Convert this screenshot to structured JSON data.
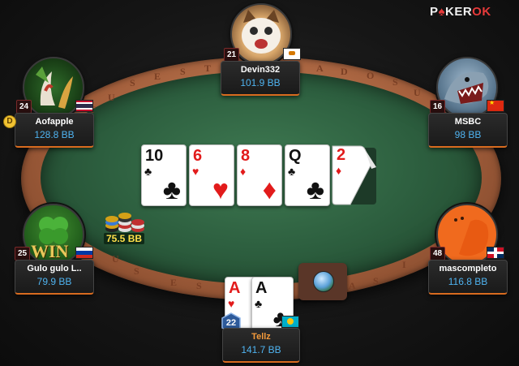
{
  "logo": {
    "pre": "P",
    "brand_rest": "KER",
    "ok": "OK"
  },
  "table": {
    "rail_text": "TUS ESTADOS UNIDOS"
  },
  "pot": {
    "amount": "75.5 BB"
  },
  "dealer_button": {
    "label": "D",
    "seat": "Aofapple"
  },
  "board": [
    {
      "rank": "10",
      "suit": "♣",
      "color": "#111111"
    },
    {
      "rank": "6",
      "suit": "♥",
      "color": "#e21b1b"
    },
    {
      "rank": "8",
      "suit": "♦",
      "color": "#e21b1b"
    },
    {
      "rank": "Q",
      "suit": "♣",
      "color": "#111111"
    },
    {
      "rank": "2",
      "suit": "♦",
      "color": "#e21b1b"
    }
  ],
  "hero_cards": [
    {
      "rank": "A",
      "suit": "♥",
      "color": "#e21b1b"
    },
    {
      "rank": "A",
      "suit": "♣",
      "color": "#111111"
    }
  ],
  "players": {
    "top": {
      "name": "Devin332",
      "stack": "101.9 BB",
      "level": "21",
      "flag": "cyprus"
    },
    "top_left": {
      "name": "Aofapple",
      "stack": "128.8 BB",
      "level": "24",
      "flag": "thailand"
    },
    "top_right": {
      "name": "MSBC",
      "stack": "98 BB",
      "level": "16",
      "flag": "china"
    },
    "left": {
      "name": "Gulo gulo L..",
      "stack": "79.9 BB",
      "level": "25",
      "flag": "russia"
    },
    "right": {
      "name": "mascompleto",
      "stack": "116.8 BB",
      "level": "48",
      "flag": "dominican-republic"
    },
    "hero": {
      "name": "Tellz",
      "stack": "141.7 BB",
      "level": "22",
      "flag": "kazakhstan"
    }
  },
  "left_avatar_text": "WIN"
}
